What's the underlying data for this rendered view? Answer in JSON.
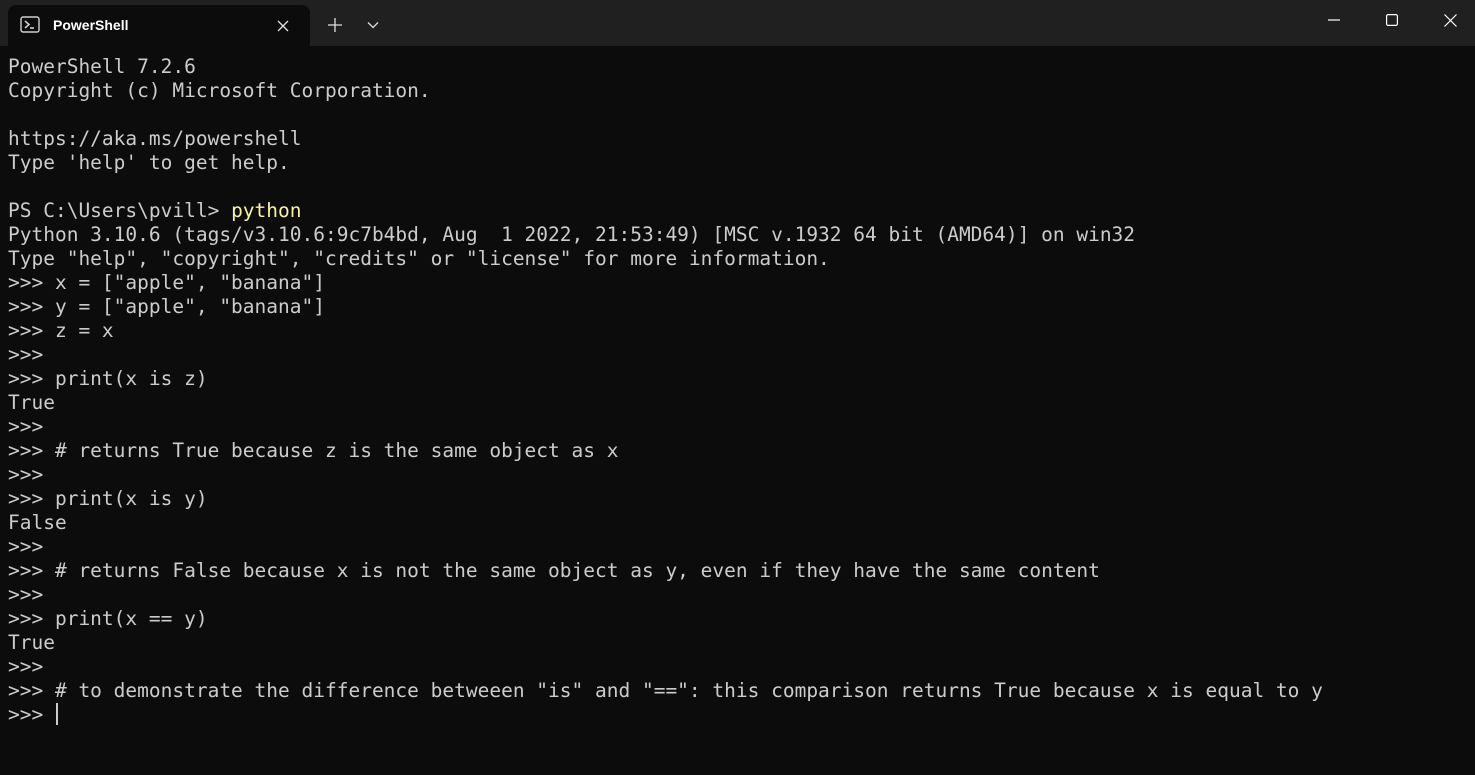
{
  "tab": {
    "title": "PowerShell",
    "icon": "powershell-icon",
    "close_icon": "close-icon"
  },
  "tabbar": {
    "new_tab_icon": "plus-icon",
    "dropdown_icon": "chevron-down-icon"
  },
  "window_controls": {
    "minimize_icon": "minimize-icon",
    "maximize_icon": "maximize-icon",
    "close_icon": "close-icon"
  },
  "colors": {
    "background": "#0c0c0c",
    "titlebar": "#202020",
    "text": "#cccccc",
    "command_highlight": "#f9f1a5"
  },
  "terminal": {
    "lines": [
      {
        "text": "PowerShell 7.2.6"
      },
      {
        "text": "Copyright (c) Microsoft Corporation."
      },
      {
        "text": ""
      },
      {
        "text": "https://aka.ms/powershell"
      },
      {
        "text": "Type 'help' to get help."
      },
      {
        "text": ""
      },
      {
        "prompt": "PS C:\\Users\\pvill> ",
        "command": "python"
      },
      {
        "text": "Python 3.10.6 (tags/v3.10.6:9c7b4bd, Aug  1 2022, 21:53:49) [MSC v.1932 64 bit (AMD64)] on win32"
      },
      {
        "text": "Type \"help\", \"copyright\", \"credits\" or \"license\" for more information."
      },
      {
        "text": ">>> x = [\"apple\", \"banana\"]"
      },
      {
        "text": ">>> y = [\"apple\", \"banana\"]"
      },
      {
        "text": ">>> z = x"
      },
      {
        "text": ">>>"
      },
      {
        "text": ">>> print(x is z)"
      },
      {
        "text": "True"
      },
      {
        "text": ">>>"
      },
      {
        "text": ">>> # returns True because z is the same object as x"
      },
      {
        "text": ">>>"
      },
      {
        "text": ">>> print(x is y)"
      },
      {
        "text": "False"
      },
      {
        "text": ">>>"
      },
      {
        "text": ">>> # returns False because x is not the same object as y, even if they have the same content"
      },
      {
        "text": ">>>"
      },
      {
        "text": ">>> print(x == y)"
      },
      {
        "text": "True"
      },
      {
        "text": ">>>"
      },
      {
        "text": ">>> # to demonstrate the difference betweeen \"is\" and \"==\": this comparison returns True because x is equal to y"
      }
    ],
    "current_prompt": ">>> "
  }
}
